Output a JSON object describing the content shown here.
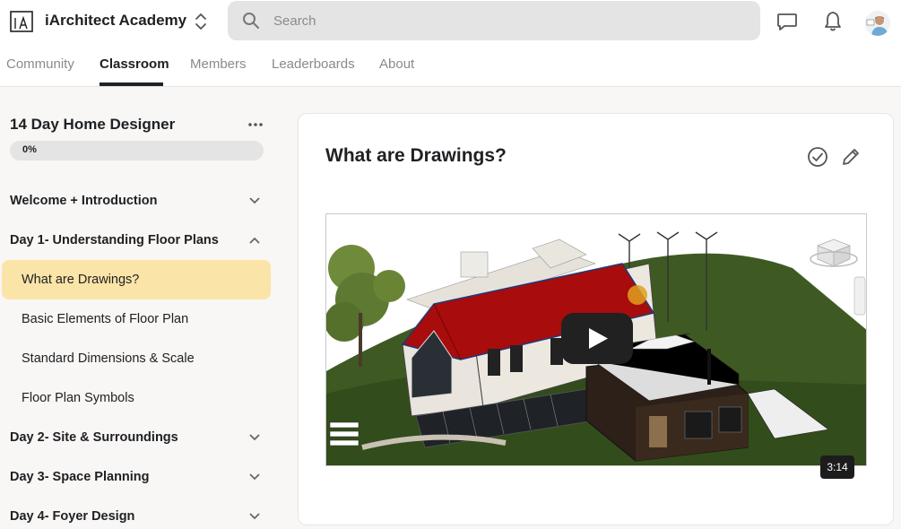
{
  "app": {
    "brand": "iArchitect Academy",
    "logo_icon": "logo-icon",
    "accent_color": "#fbe4a7"
  },
  "search": {
    "placeholder": "Search",
    "value": ""
  },
  "header_icons": [
    "chat-icon",
    "bell-icon",
    "avatar"
  ],
  "tabs": [
    {
      "label": "Community",
      "active": false
    },
    {
      "label": "Classroom",
      "active": true
    },
    {
      "label": "Members",
      "active": false
    },
    {
      "label": "Leaderboards",
      "active": false
    },
    {
      "label": "About",
      "active": false
    }
  ],
  "course": {
    "title": "14 Day Home Designer",
    "progress_label": "0%",
    "progress_value": 0
  },
  "sections": [
    {
      "label": "Welcome + Introduction",
      "expanded": false
    },
    {
      "label": "Day 1- Understanding Floor Plans",
      "expanded": true
    },
    {
      "label": "Day 2- Site & Surroundings",
      "expanded": false
    },
    {
      "label": "Day 3- Space Planning",
      "expanded": false
    },
    {
      "label": "Day 4- Foyer Design",
      "expanded": false
    }
  ],
  "lessons": [
    {
      "label": "What are Drawings?",
      "active": true
    },
    {
      "label": "Basic Elements of Floor Plan",
      "active": false
    },
    {
      "label": "Standard Dimensions & Scale",
      "active": false
    },
    {
      "label": "Floor Plan Symbols",
      "active": false
    }
  ],
  "main": {
    "lesson_title": "What are Drawings?",
    "actions": [
      "check-circle-icon",
      "pencil-icon"
    ],
    "video": {
      "duration": "3:14",
      "play_icon": "play-icon"
    }
  }
}
